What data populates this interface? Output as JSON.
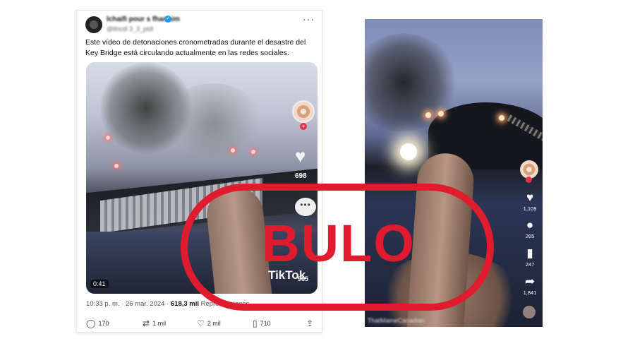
{
  "tweet": {
    "author_name": "lchaifi pour s fhar aim",
    "handle": "@lihcdl 3_3_pidl",
    "text": "Este vídeo de detonaciones cronometradas durante el desastre del Key Bridge está circulando actualmente en las redes sociales.",
    "video_duration": "0:41",
    "tiktok_overlay": {
      "likes": "698",
      "logo": "TikTok",
      "shares": "965"
    },
    "timestamp": "10:33 p. m. · 26 mar. 2024 ·",
    "views": "618,3 mil",
    "views_label": "Reproducciones",
    "actions": {
      "replies": "170",
      "retweets": "1 mil",
      "likes": "2 mil",
      "bookmarks": "710"
    }
  },
  "tiktok": {
    "likes": "1,109",
    "comments": "265",
    "bookmarks": "247",
    "shares": "1,841",
    "username": "ThatMaineCanadian"
  },
  "stamp": {
    "label": "BULO",
    "color": "#e11b2e"
  },
  "icons": [
    "verified-icon",
    "more-icon",
    "heart-icon",
    "comment-icon",
    "reply-icon",
    "retweet-icon",
    "like-icon",
    "bookmark-icon",
    "share-icon"
  ]
}
